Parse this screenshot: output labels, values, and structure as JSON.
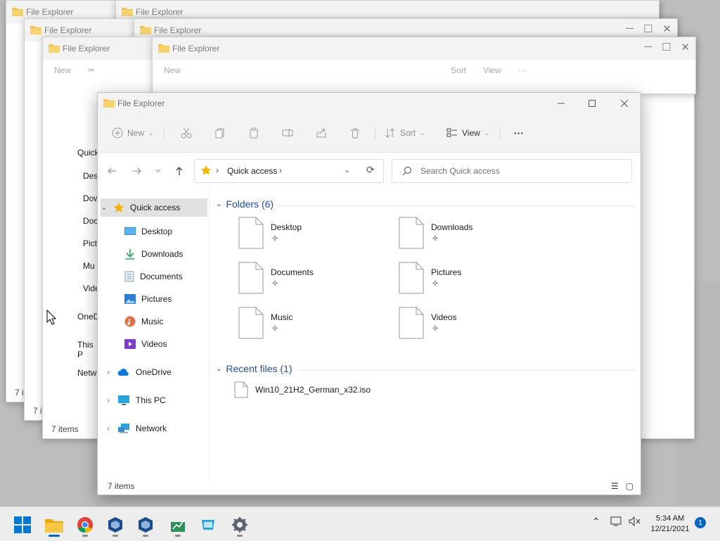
{
  "app": {
    "title": "File Explorer"
  },
  "toolbar": {
    "new_label": "New",
    "sort_label": "Sort",
    "view_label": "View",
    "more_label": "···"
  },
  "address": {
    "crumb": "Quick access",
    "search_placeholder": "Search Quick access"
  },
  "nav": {
    "quick_access": "Quick access",
    "pinned": [
      {
        "label": "Desktop",
        "icon": "desktop-icon"
      },
      {
        "label": "Downloads",
        "icon": "downloads-icon"
      },
      {
        "label": "Documents",
        "icon": "documents-icon"
      },
      {
        "label": "Pictures",
        "icon": "pictures-icon"
      },
      {
        "label": "Music",
        "icon": "music-icon"
      },
      {
        "label": "Videos",
        "icon": "videos-icon"
      }
    ],
    "onedrive": "OneDrive",
    "thispc": "This PC",
    "network": "Network"
  },
  "content": {
    "folders_heading": "Folders (6)",
    "folders": [
      {
        "name": "Desktop"
      },
      {
        "name": "Downloads"
      },
      {
        "name": "Documents"
      },
      {
        "name": "Pictures"
      },
      {
        "name": "Music"
      },
      {
        "name": "Videos"
      }
    ],
    "recent_heading": "Recent files (1)",
    "recent": [
      {
        "name": "Win10_21H2_German_x32.iso"
      }
    ]
  },
  "status": {
    "items": "7 items"
  },
  "bg": {
    "items": "7 items",
    "nav_partial": [
      "Quick",
      "Des",
      "Dow",
      "Doc",
      "Pict",
      "Mu",
      "Vide",
      "OneD",
      "This P",
      "Netw"
    ]
  },
  "clock": {
    "time": "5:34 AM",
    "date": "12/21/2021"
  },
  "notifications": {
    "count": "1"
  },
  "colors": {
    "accent": "#0067c0",
    "folder": "#f2c14e",
    "selected": "#e1e1e1"
  }
}
